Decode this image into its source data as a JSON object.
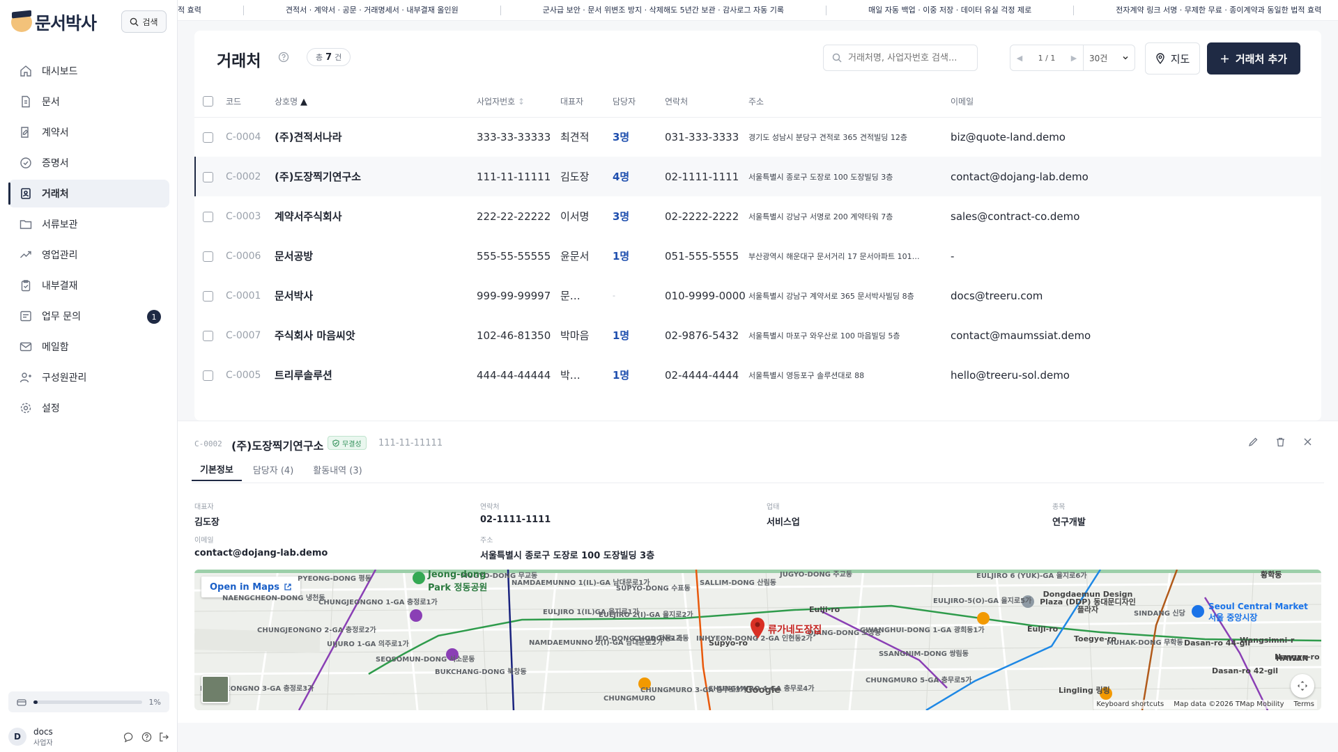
{
  "brand": {
    "name": "문서박사"
  },
  "search_button": {
    "label": "검색"
  },
  "nav": [
    {
      "label": "대시보드",
      "icon": "home-icon"
    },
    {
      "label": "문서",
      "icon": "document-icon"
    },
    {
      "label": "계약서",
      "icon": "contract-icon"
    },
    {
      "label": "증명서",
      "icon": "certificate-icon"
    },
    {
      "label": "거래처",
      "icon": "contact-card-icon",
      "active": true
    },
    {
      "label": "서류보관",
      "icon": "folder-icon"
    },
    {
      "label": "영업관리",
      "icon": "trend-icon"
    },
    {
      "label": "내부결재",
      "icon": "clipboard-icon"
    },
    {
      "label": "업무 문의",
      "icon": "inquiry-icon",
      "badge": "1"
    },
    {
      "label": "메일함",
      "icon": "mail-icon"
    },
    {
      "label": "구성원관리",
      "icon": "users-icon"
    },
    {
      "label": "설정",
      "icon": "gear-icon"
    }
  ],
  "storage": {
    "percent_label": "1%",
    "fill_fraction": 0.01
  },
  "user": {
    "initial": "D",
    "name": "docs",
    "role": "사업자"
  },
  "ticker": [
    "적 효력",
    "견적서 · 계약서 · 공문 · 거래명세서 · 내부결재 올인원",
    "군사급 보안 · 문서 위변조 방지 · 삭제해도 5년간 보관 · 감사로그 자동 기록",
    "매일 자동 백업 · 이중 저장 · 데이터 유실 걱정 제로",
    "전자계약 링크 서명 · 무제한 무료 · 종이계약과 동일한 법적 효력"
  ],
  "header": {
    "title": "거래처",
    "count_prefix": "총",
    "count": "7",
    "count_suffix": "건",
    "search_placeholder": "거래처명, 사업자번호 검색...",
    "page": "1 / 1",
    "per_page": "30건",
    "map_button": "지도",
    "add_button": "거래처 추가"
  },
  "columns": {
    "code": "코드",
    "name": "상호명",
    "name_sort": "▲",
    "biz": "사업자번호",
    "biz_sort": "↕",
    "ceo": "대표자",
    "manager": "담당자",
    "phone": "연락처",
    "address": "주소",
    "email": "이메일"
  },
  "rows": [
    {
      "code": "C-0004",
      "name": "(주)견적서나라",
      "biz": "333-33-33333",
      "ceo": "최견적",
      "manager": "3명",
      "phone": "031-333-3333",
      "address": "경기도 성남시 분당구 견적로 365 견적빌딩 12층",
      "email": "biz@quote-land.demo"
    },
    {
      "code": "C-0002",
      "name": "(주)도장찍기연구소",
      "biz": "111-11-11111",
      "ceo": "김도장",
      "manager": "4명",
      "phone": "02-1111-1111",
      "address": "서울특별시 종로구 도장로 100 도장빌딩 3층",
      "email": "contact@dojang-lab.demo",
      "selected": true
    },
    {
      "code": "C-0003",
      "name": "계약서주식회사",
      "biz": "222-22-22222",
      "ceo": "이서명",
      "manager": "3명",
      "phone": "02-2222-2222",
      "address": "서울특별시 강남구 서명로 200 계약타워 7층",
      "email": "sales@contract-co.demo"
    },
    {
      "code": "C-0006",
      "name": "문서공방",
      "biz": "555-55-55555",
      "ceo": "윤문서",
      "manager": "1명",
      "phone": "051-555-5555",
      "address": "부산광역시 해운대구 문서거리 17 문서아파트 101…",
      "email": "-"
    },
    {
      "code": "C-0001",
      "name": "문서박사",
      "biz": "999-99-99997",
      "ceo": "문…",
      "manager": "-",
      "phone": "010-9999-0000",
      "address": "서울특별시 강남구 계약서로 365 문서박사빌딩 8층",
      "email": "docs@treeru.com"
    },
    {
      "code": "C-0007",
      "name": "주식회사 마음씨앗",
      "biz": "102-46-81350",
      "ceo": "박마음",
      "manager": "1명",
      "phone": "02-9876-5432",
      "address": "서울특별시 마포구 와우산로 100 마음빌딩 5층",
      "email": "contact@maumssiat.demo"
    },
    {
      "code": "C-0005",
      "name": "트리루솔루션",
      "biz": "444-44-44444",
      "ceo": "박…",
      "manager": "1명",
      "phone": "02-4444-4444",
      "address": "서울특별시 영등포구 솔루션대로 88",
      "email": "hello@treeru-sol.demo"
    }
  ],
  "detail": {
    "code": "C-0002",
    "name": "(주)도장찍기연구소",
    "badge": "무결성",
    "biz": "111-11-11111",
    "tabs": [
      "기본정보",
      "담당자 (4)",
      "활동내역 (3)"
    ],
    "fields": {
      "ceo_label": "대표자",
      "ceo": "김도장",
      "phone_label": "연락처",
      "phone": "02-1111-1111",
      "type_label": "업태",
      "type": "서비스업",
      "item_label": "종목",
      "item": "연구개발",
      "email_label": "이메일",
      "email": "contact@dojang-lab.demo",
      "address_label": "주소",
      "address": "서울특별시 종로구 도장로 100 도장빌딩 3층"
    }
  },
  "map": {
    "open_in_maps": "Open in Maps",
    "pin_label": "류가네도장집",
    "google": "Google",
    "footer": [
      "Keyboard shortcuts",
      "Map data ©2026 TMap Mobility",
      "Terms"
    ],
    "labels": [
      "PYEONG-DONG 평동",
      "NAENGCHEON-DONG 냉천동",
      "CHUNGJEONGNO 1-GA 충정로1가",
      "CHUNGJEONGNO 2-GA 충정로2가",
      "UIJURO 1-GA 의주로1가",
      "SEOSOMUN-DONG 서소문동",
      "BUKCHANG-DONG 북창동",
      "MUGYO-DONG 무교동",
      "NAMDAEMUNNO 1(IL)-GA 남대문로1가",
      "EULJIRO 1(IL)GA 을지로1가",
      "EULJIRO 2(I)-GA 을지로2가",
      "SUPYO-DONG 수표동",
      "NAMDAEMUNNO 2(I)-GA 남대문로2가",
      "JEO-DONG 1-GA 저동1가",
      "CHODONG 초동",
      "INHYEON-DONG 2-GA 인현동2가",
      "SALLIM-DONG 산림동",
      "JUGYO-DONG 주교동",
      "OJANG-DONG 오장동",
      "GWANGHUI-DONG 1-GA 광희동1가",
      "SSANGNIM-DONG 쌍림동",
      "CHUNGMURO 5-GA 충무로5가",
      "CHUNGMURO 4-GA 충무로4가",
      "CHUNGMURO 3-GA 충무로3가",
      "CHUNGMURO",
      "EULJIRO 6 (YUK)-GA 을지로6가",
      "MUHAK-DONG 무학동",
      "SINDANG 신당",
      "EULJIRO-5(O)-GA 을지로5가",
      "HUNGJEONGNO 3-GA 충정로3가"
    ],
    "green_labels": [
      "Jeong-dong Park 정동공원"
    ],
    "blue_labels": [
      "Seoul Central Market 서울 중앙시장"
    ],
    "other_labels": [
      "Dongdaemun Design Plaza (DDP) 동대문디자인플라자",
      "Lingling 링링",
      "Eulji-ro",
      "Toegye-ro",
      "Wangsimni-r",
      "Dasan-ro 44-gil",
      "Dasan-ro 42-gil",
      "Nangye-ro",
      "Supyo-ro",
      "Eulji-ro",
      "HAWAN",
      "황학동",
      "황학동"
    ]
  },
  "colors": {
    "primary": "#1f2a44",
    "accent_blue": "#1f4fae",
    "success": "#2f8f57"
  }
}
